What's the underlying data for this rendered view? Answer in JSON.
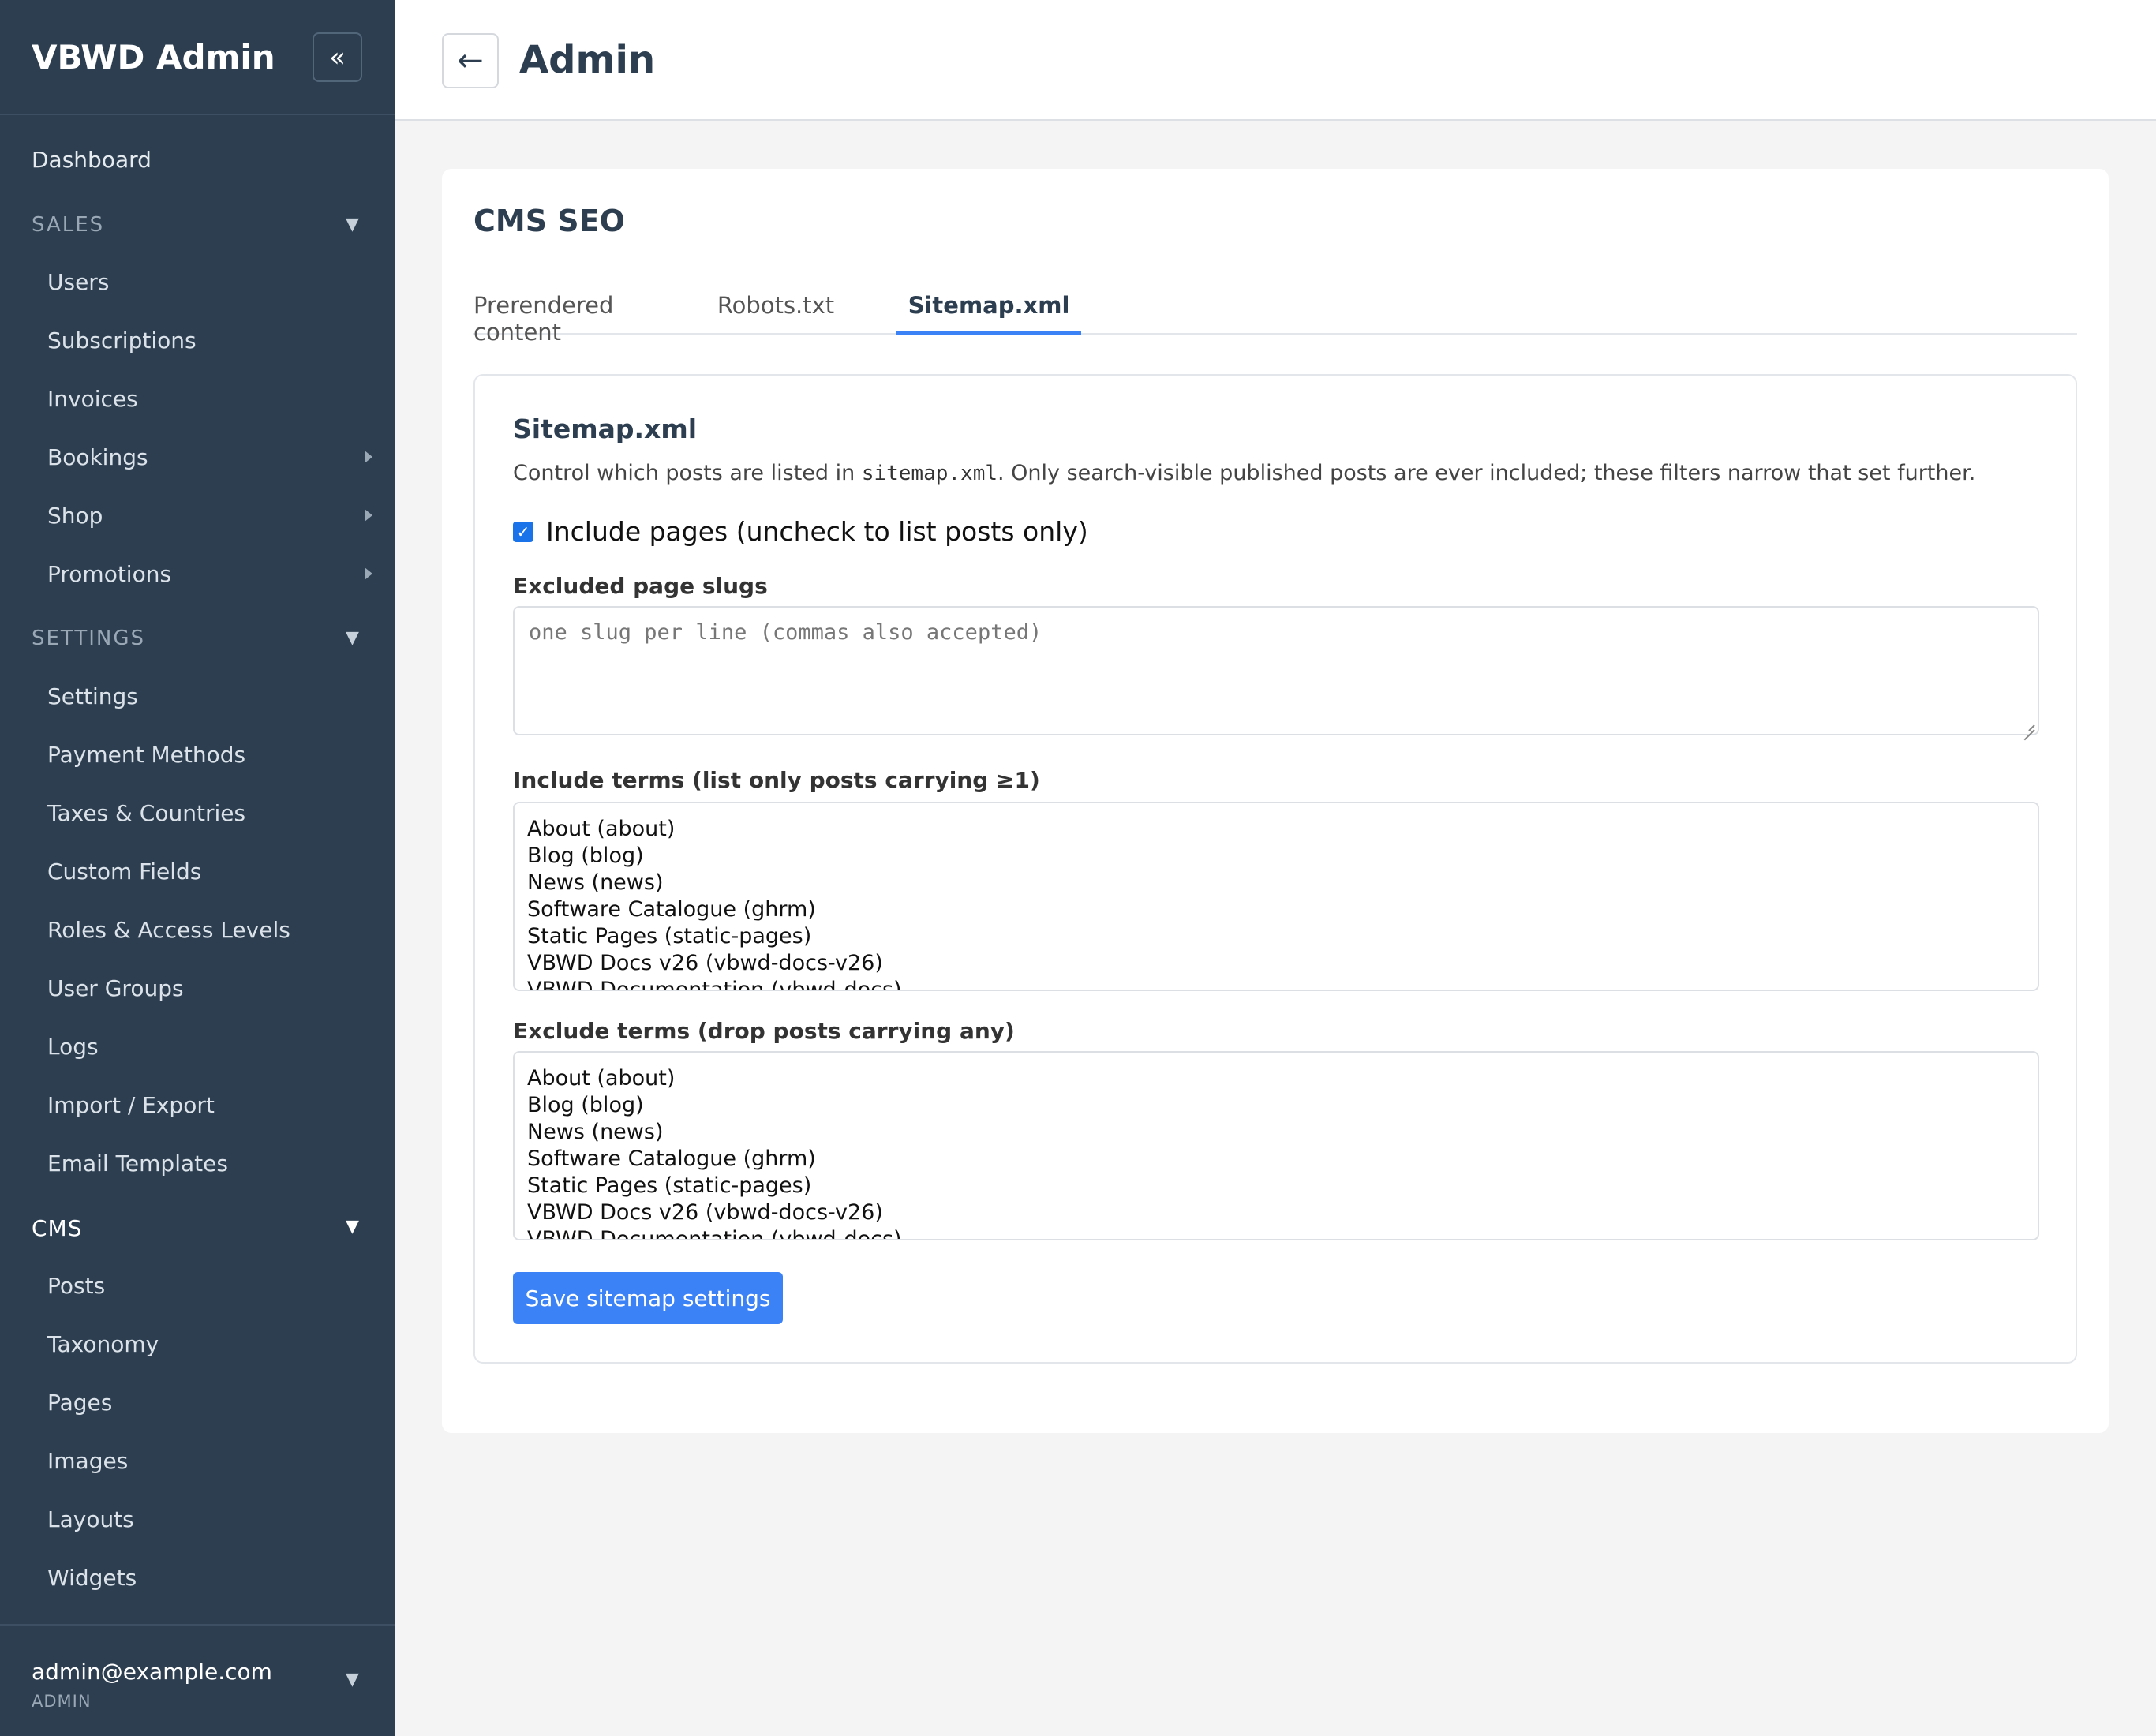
{
  "sidebar": {
    "brand": "VBWD Admin",
    "collapse_icon": "«",
    "dashboard": "Dashboard",
    "groups": {
      "sales": {
        "label": "SALES",
        "items": [
          "Users",
          "Subscriptions",
          "Invoices",
          "Bookings",
          "Shop",
          "Promotions"
        ]
      },
      "settings": {
        "label": "SETTINGS",
        "items": [
          "Settings",
          "Payment Methods",
          "Taxes & Countries",
          "Custom Fields",
          "Roles & Access Levels",
          "User Groups",
          "Logs",
          "Import / Export",
          "Email Templates"
        ]
      },
      "cms": {
        "label": "CMS",
        "items": [
          "Posts",
          "Taxonomy",
          "Pages",
          "Images",
          "Layouts",
          "Widgets"
        ]
      }
    },
    "user": {
      "email": "admin@example.com",
      "role": "ADMIN"
    }
  },
  "topbar": {
    "back_icon": "←",
    "title": "Admin"
  },
  "card": {
    "title": "CMS SEO",
    "tabs": [
      {
        "label": "Prerendered content",
        "active": false
      },
      {
        "label": "Robots.txt",
        "active": false
      },
      {
        "label": "Sitemap.xml",
        "active": true
      }
    ]
  },
  "panel": {
    "title": "Sitemap.xml",
    "desc_before": "Control which posts are listed in ",
    "desc_code": "sitemap.xml",
    "desc_after": ". Only search-visible published posts are ever included; these filters narrow that set further.",
    "include_pages": {
      "label": "Include pages (uncheck to list posts only)",
      "checked": true
    },
    "excluded_slugs": {
      "label": "Excluded page slugs",
      "placeholder": "one slug per line (commas also accepted)"
    },
    "include_terms": {
      "label": "Include terms (list only posts carrying ≥1)",
      "options": [
        "About (about)",
        "Blog (blog)",
        "News (news)",
        "Software Catalogue (ghrm)",
        "Static Pages (static-pages)",
        "VBWD Docs v26 (vbwd-docs-v26)",
        "VBWD Documentation (vbwd-docs)"
      ]
    },
    "exclude_terms": {
      "label": "Exclude terms (drop posts carrying any)",
      "options": [
        "About (about)",
        "Blog (blog)",
        "News (news)",
        "Software Catalogue (ghrm)",
        "Static Pages (static-pages)",
        "VBWD Docs v26 (vbwd-docs-v26)",
        "VBWD Documentation (vbwd-docs)"
      ]
    },
    "save_label": "Save sitemap settings"
  },
  "colors": {
    "sidebar_bg": "#2c3e50",
    "accent": "#3b82f6",
    "page_bg": "#f4f4f4"
  }
}
